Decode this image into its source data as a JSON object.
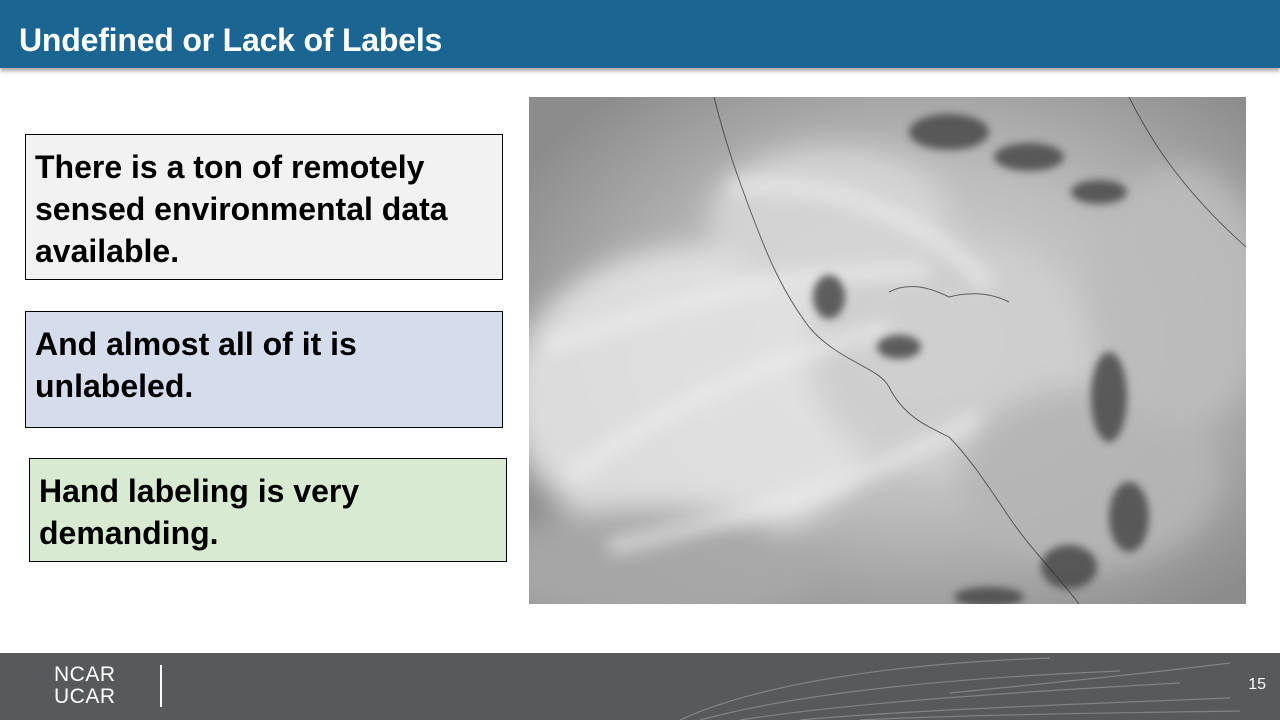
{
  "slide": {
    "title": "Undefined or Lack of Labels",
    "page_number": "15"
  },
  "boxes": [
    {
      "text": "There is a ton of remotely sensed environmental data available.",
      "color": "#f2f2f2"
    },
    {
      "text": "And almost all of it is unlabeled.",
      "color": "#d5dcec"
    },
    {
      "text": "Hand labeling is very demanding.",
      "color": "#d9ead3"
    }
  ],
  "footer": {
    "logo_line1": "NCAR",
    "logo_line2": "UCAR"
  },
  "colors": {
    "header": "#1b6592",
    "footer": "#58595b"
  }
}
